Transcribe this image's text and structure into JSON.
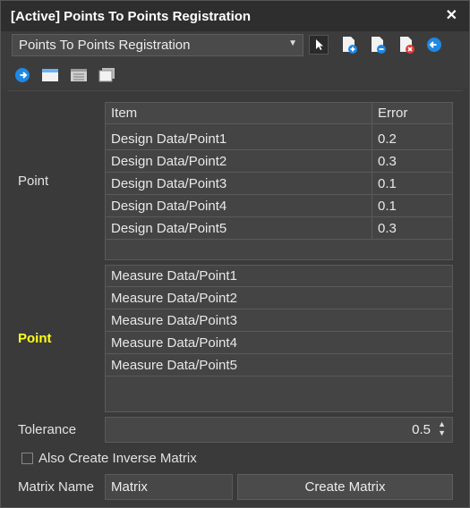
{
  "window": {
    "title": "[Active] Points To Points Registration",
    "close_glyph": "✕"
  },
  "toolbar": {
    "dropdown_value": "Points To Points Registration",
    "icons": [
      "pointer-icon",
      "add-document-icon",
      "remove-document-icon",
      "delete-document-icon",
      "arrow-left-icon",
      "arrow-right-icon",
      "window-icon",
      "list-window-icon",
      "copy-window-icon"
    ]
  },
  "point_section": {
    "label": "Point",
    "columns": [
      "Item",
      "Error"
    ],
    "rows": [
      {
        "item": "Design Data/Point1",
        "error": "0.2"
      },
      {
        "item": "Design Data/Point2",
        "error": "0.3"
      },
      {
        "item": "Design Data/Point3",
        "error": "0.1"
      },
      {
        "item": "Design Data/Point4",
        "error": "0.1"
      },
      {
        "item": "Design Data/Point5",
        "error": "0.3"
      }
    ]
  },
  "measure_section": {
    "label": "Point",
    "rows": [
      "Measure Data/Point1",
      "Measure Data/Point2",
      "Measure Data/Point3",
      "Measure Data/Point4",
      "Measure Data/Point5"
    ]
  },
  "tolerance": {
    "label": "Tolerance",
    "value": "0.5"
  },
  "inverse": {
    "label": "Also Create Inverse Matrix",
    "checked": false
  },
  "matrix": {
    "label": "Matrix Name",
    "value": "Matrix",
    "button": "Create Matrix"
  }
}
